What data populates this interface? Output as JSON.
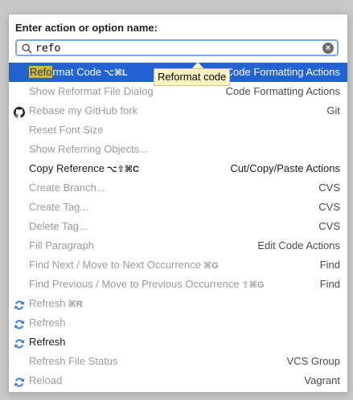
{
  "popup": {
    "title": "Enter action or option name:",
    "search_value": "refo"
  },
  "tooltip": {
    "text": "Reformat code"
  },
  "colors": {
    "selection": "#2262d2",
    "highlight": "#c9b84a",
    "tooltip_bg": "#fdf6c3"
  },
  "items": [
    {
      "highlight": "Refo",
      "rest": "rmat Code",
      "shortcut": "⌥⌘L",
      "group": "Code Formatting Actions",
      "icon": "",
      "state": "selected"
    },
    {
      "highlight": "",
      "rest": "Show Reformat File Dialog",
      "shortcut": "",
      "group": "Code Formatting Actions",
      "icon": "",
      "state": "disabled"
    },
    {
      "highlight": "",
      "rest": "Rebase my GitHub fork",
      "shortcut": "",
      "group": "Git",
      "icon": "github-icon",
      "state": "disabled"
    },
    {
      "highlight": "",
      "rest": "Reset Font Size",
      "shortcut": "",
      "group": "",
      "icon": "",
      "state": "disabled"
    },
    {
      "highlight": "",
      "rest": "Show Referring Objects...",
      "shortcut": "",
      "group": "",
      "icon": "",
      "state": "disabled"
    },
    {
      "highlight": "",
      "rest": "Copy Reference",
      "shortcut": "⌥⇧⌘C",
      "group": "Cut/Copy/Paste Actions",
      "icon": "",
      "state": "enabled"
    },
    {
      "highlight": "",
      "rest": "Create Branch...",
      "shortcut": "",
      "group": "CVS",
      "icon": "",
      "state": "disabled"
    },
    {
      "highlight": "",
      "rest": "Create Tag...",
      "shortcut": "",
      "group": "CVS",
      "icon": "",
      "state": "disabled"
    },
    {
      "highlight": "",
      "rest": "Delete Tag...",
      "shortcut": "",
      "group": "CVS",
      "icon": "",
      "state": "disabled"
    },
    {
      "highlight": "",
      "rest": "Fill Paragraph",
      "shortcut": "",
      "group": "Edit Code Actions",
      "icon": "",
      "state": "disabled"
    },
    {
      "highlight": "",
      "rest": "Find Next / Move to Next Occurrence",
      "shortcut": "⌘G",
      "group": "Find",
      "icon": "",
      "state": "disabled"
    },
    {
      "highlight": "",
      "rest": "Find Previous / Move to Previous Occurrence",
      "shortcut": "⇧⌘G",
      "group": "Find",
      "icon": "",
      "state": "disabled"
    },
    {
      "highlight": "",
      "rest": "Refresh",
      "shortcut": "⌘R",
      "group": "",
      "icon": "refresh-icon",
      "state": "disabled"
    },
    {
      "highlight": "",
      "rest": "Refresh",
      "shortcut": "",
      "group": "",
      "icon": "refresh-icon",
      "state": "disabled"
    },
    {
      "highlight": "",
      "rest": "Refresh",
      "shortcut": "",
      "group": "",
      "icon": "refresh-icon",
      "state": "enabled"
    },
    {
      "highlight": "",
      "rest": "Refresh File Status",
      "shortcut": "",
      "group": "VCS Group",
      "icon": "",
      "state": "disabled"
    },
    {
      "highlight": "",
      "rest": "Reload",
      "shortcut": "",
      "group": "Vagrant",
      "icon": "refresh-icon",
      "state": "disabled"
    }
  ]
}
